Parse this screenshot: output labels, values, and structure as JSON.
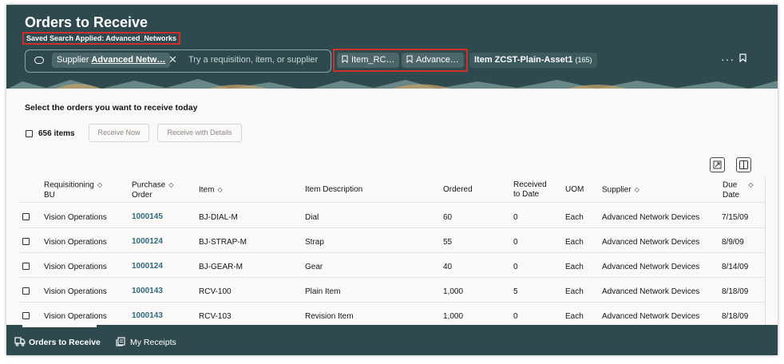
{
  "header": {
    "title": "Orders to Receive",
    "saved_search": "Saved Search Applied: Advanced_Networks",
    "search": {
      "chip_prefix": "Supplier",
      "chip_value": "Advanced Netw…",
      "placeholder": "Try a requisition, item, or supplier"
    },
    "saved_chips": [
      "Item_RC…",
      "Advance…"
    ],
    "item_chip": {
      "label": "Item ZCST-Plain-Asset1",
      "count": "(165)"
    },
    "more_label": "···"
  },
  "main": {
    "instruction": "Select the orders you want to receive today",
    "items_count": "656 items",
    "receive_now": "Receive Now",
    "receive_with_details": "Receive with Details"
  },
  "table": {
    "headers": {
      "req_bu_1": "Requisitioning",
      "req_bu_2": "BU",
      "po_1": "Purchase",
      "po_2": "Order",
      "item": "Item",
      "desc": "Item Description",
      "ordered": "Ordered",
      "rtd_1": "Received",
      "rtd_2": "to Date",
      "uom": "UOM",
      "supplier": "Supplier",
      "due_1": "Due",
      "due_2": "Date"
    },
    "rows": [
      {
        "bu": "Vision Operations",
        "po": "1000145",
        "item": "BJ-DIAL-M",
        "desc": "Dial",
        "ordered": "60",
        "received": "0",
        "uom": "Each",
        "supplier": "Advanced Network Devices",
        "due": "7/15/09"
      },
      {
        "bu": "Vision Operations",
        "po": "1000124",
        "item": "BJ-STRAP-M",
        "desc": "Strap",
        "ordered": "55",
        "received": "0",
        "uom": "Each",
        "supplier": "Advanced Network Devices",
        "due": "8/9/09"
      },
      {
        "bu": "Vision Operations",
        "po": "1000124",
        "item": "BJ-GEAR-M",
        "desc": "Gear",
        "ordered": "40",
        "received": "0",
        "uom": "Each",
        "supplier": "Advanced Network Devices",
        "due": "8/14/09"
      },
      {
        "bu": "Vision Operations",
        "po": "1000143",
        "item": "RCV-100",
        "desc": "Plain Item",
        "ordered": "1,000",
        "received": "5",
        "uom": "Each",
        "supplier": "Advanced Network Devices",
        "due": "8/18/09"
      },
      {
        "bu": "Vision Operations",
        "po": "1000143",
        "item": "RCV-103",
        "desc": "Revision Item",
        "ordered": "1,000",
        "received": "0",
        "uom": "Each",
        "supplier": "Advanced Network Devices",
        "due": "8/18/09"
      }
    ]
  },
  "footer": {
    "tab_orders": "Orders to Receive",
    "tab_receipts": "My Receipts"
  },
  "colors": {
    "header_bg": "#2f4a4e",
    "link": "#2b6a7c",
    "highlight_box": "#d0302b"
  }
}
